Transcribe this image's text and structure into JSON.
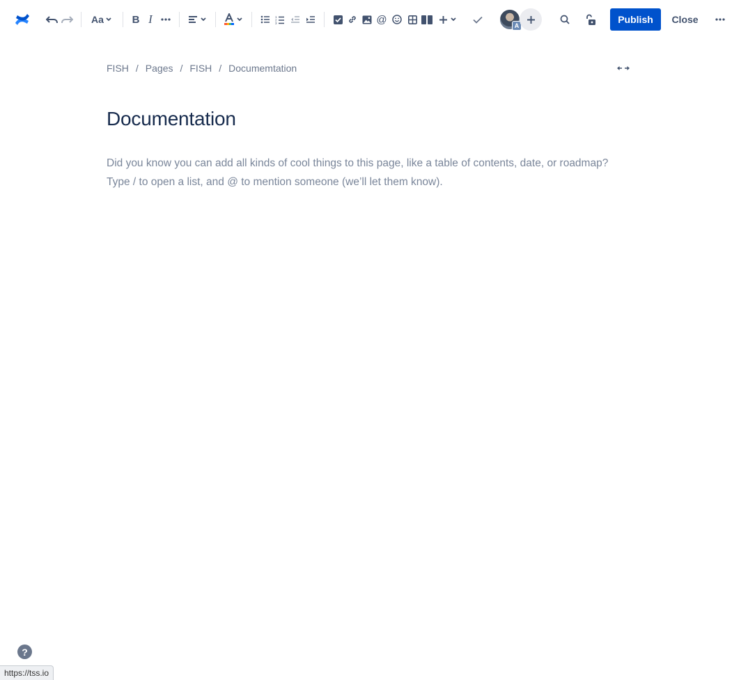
{
  "toolbar": {
    "text_style_label": "Aa",
    "more_label": "···",
    "publish_label": "Publish",
    "close_label": "Close",
    "avatar_badge": "A"
  },
  "breadcrumb": {
    "items": [
      "FISH",
      "Pages",
      "FISH",
      "Documemtation"
    ],
    "separator": "/"
  },
  "page": {
    "title": "Documentation",
    "placeholder_line1": "Did you know you can add all kinds of cool things to this page, like a table of contents, date, or roadmap?",
    "placeholder_line2": "Type / to open a list, and @ to mention someone (we’ll let them know)."
  },
  "help_label": "?",
  "status_url": "https://tss.io",
  "colors": {
    "accent": "#0052cc",
    "logo_blue": "#2684ff",
    "text_primary": "#172b4d",
    "text_muted": "#7a869a"
  }
}
